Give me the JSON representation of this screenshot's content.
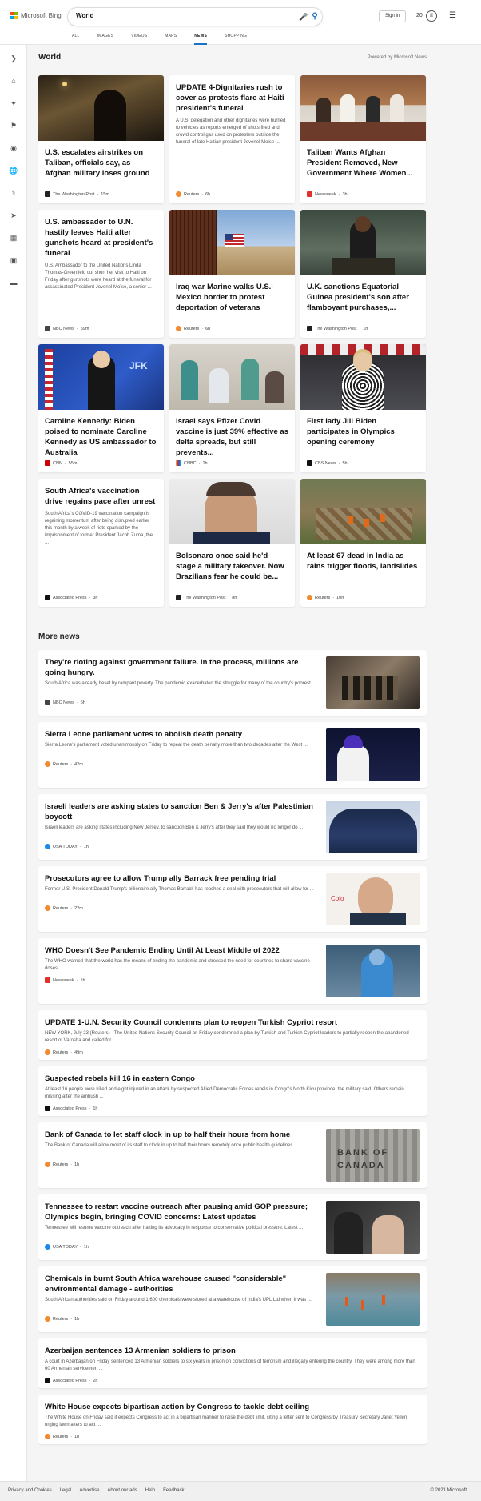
{
  "header": {
    "brand": "Microsoft Bing",
    "query": "World",
    "signin": "Sign in",
    "points": "20",
    "nav": [
      "ALL",
      "IMAGES",
      "VIDEOS",
      "MAPS",
      "NEWS",
      "SHOPPING"
    ],
    "active_nav": "NEWS"
  },
  "colors": {
    "accent": "#1a73c8",
    "ms_red": "#f25022",
    "ms_green": "#7fba00",
    "ms_blue": "#00a4ef",
    "ms_yellow": "#ffb900"
  },
  "sidebar": [
    "chevron-right-icon",
    "home-icon",
    "sparkle-icon",
    "flag-icon",
    "location-pin-icon",
    "globe-icon",
    "microscope-icon",
    "rocket-icon",
    "film-icon",
    "briefcase-icon",
    "card-icon"
  ],
  "section": {
    "title": "World",
    "powered": "Powered by Microsoft News"
  },
  "cards": [
    {
      "title": "U.S. escalates airstrikes on Taliban, officials say, as Afghan military loses ground",
      "source": "The Washington Post",
      "time": "15m"
    },
    {
      "title": "UPDATE 4-Dignitaries rush to cover as protests flare at Haiti president's funeral",
      "snippet": "A U.S. delegation and other dignitaries were hurried to vehicles as reports emerged of shots fired and crowd control gas used on protesters outside the funeral of late Haitian president Jovenel Moise ...",
      "source": "Reuters",
      "time": "6h"
    },
    {
      "title": "Taliban Wants Afghan President Removed, New Government Where Women...",
      "source": "Newsweek",
      "time": "3h"
    },
    {
      "title": "U.S. ambassador to U.N. hastily leaves Haiti after gunshots heard at president's funeral",
      "snippet": "U.S. Ambassador to the United Nations Linda Thomas-Greenfield cut short her visit to Haiti on Friday after gunshots were heard at the funeral for assassinated President Jovenel Moïse, a senior ...",
      "source": "NBC News",
      "time": "59m"
    },
    {
      "title": "Iraq war Marine walks U.S.-Mexico border to protest deportation of veterans",
      "source": "Reuters",
      "time": "6h"
    },
    {
      "title": "U.K. sanctions Equatorial Guinea president's son after flamboyant purchases,...",
      "source": "The Washington Post",
      "time": "1h"
    },
    {
      "title": "Caroline Kennedy: Biden poised to nominate Caroline Kennedy as US ambassador to Australia",
      "source": "CNN",
      "time": "55m"
    },
    {
      "title": "Israel says Pfizer Covid vaccine is just 39% effective as delta spreads, but still prevents...",
      "source": "CNBC",
      "time": "1h"
    },
    {
      "title": "First lady Jill Biden participates in Olympics opening ceremony",
      "source": "CBS News",
      "time": "5h"
    },
    {
      "title": "South Africa's vaccination drive regains pace after unrest",
      "snippet": "South Africa's COVID-19 vaccination campaign is regaining momentum after being disrupted earlier this month by a week of riots sparked by the imprisonment of former President Jacob Zuma, the ...",
      "source": "Associated Press",
      "time": "3h"
    },
    {
      "title": "Bolsonaro once said he'd stage a military takeover. Now Brazilians fear he could be...",
      "source": "The Washington Post",
      "time": "8h"
    },
    {
      "title": "At least 67 dead in India as rains trigger floods, landslides",
      "source": "Reuters",
      "time": "10h"
    }
  ],
  "more": {
    "title": "More news",
    "items": [
      {
        "title": "They're rioting against government failure. In the process, millions are going hungry.",
        "snippet": "South Africa was already beset by rampant poverty. The pandemic exacerbated the struggle for many of the country's poorest.",
        "source": "NBC News",
        "time": "6h"
      },
      {
        "title": "Sierra Leone parliament votes to abolish death penalty",
        "snippet": "Sierra Leone's parliament voted unanimously on Friday to repeal the death penalty more than two decades after the West ...",
        "source": "Reuters",
        "time": "42m"
      },
      {
        "title": "Israeli leaders are asking states to sanction Ben & Jerry's after Palestinian boycott",
        "snippet": "Israeli leaders are asking states including New Jersey, to sanction Ben & Jerry's after they said they would no longer do ...",
        "source": "USA TODAY",
        "time": "1h"
      },
      {
        "title": "Prosecutors agree to allow Trump ally Barrack free pending trial",
        "snippet": "Former U.S. President Donald Trump's billionaire ally Thomas Barrack has reached a deal with prosecutors that will allow for ...",
        "source": "Reuters",
        "time": "22m"
      },
      {
        "title": "WHO Doesn't See Pandemic Ending Until At Least Middle of 2022",
        "snippet": "The WHO warned that the world has the means of ending the pandemic and stressed the need for countries to share vaccine doses ...",
        "source": "Newsweek",
        "time": "1h"
      },
      {
        "title": "UPDATE 1-U.N. Security Council condemns plan to reopen Turkish Cypriot resort",
        "snippet": "NEW YORK, July 23 (Reuters) - The United Nations Security Council on Friday condemned a plan by Turkish and Turkish Cypriot leaders to partially reopen the abandoned resort of Varosha and called for ...",
        "source": "Reuters",
        "time": "49m"
      },
      {
        "title": "Suspected rebels kill 16 in eastern Congo",
        "snippet": "At least 16 people were killed and eight injured in an attack by suspected Allied Democratic Forces rebels in Congo's North Kivu province, the military said. Others remain missing after the ambush ...",
        "source": "Associated Press",
        "time": "1h"
      },
      {
        "title": "Bank of Canada to let staff clock in up to half their hours from home",
        "snippet": "The Bank of Canada will allow most of its staff to clock in up to half their hours remotely once public health guidelines ...",
        "source": "Reuters",
        "time": "1h"
      },
      {
        "title": "Tennessee to restart vaccine outreach after pausing amid GOP pressure; Olympics begin, bringing COVID concerns: Latest updates",
        "snippet": "Tennessee will resume vaccine outreach after halting its advocacy in response to conservative political pressure. Latest ...",
        "source": "USA TODAY",
        "time": "1h"
      },
      {
        "title": "Chemicals in burnt South Africa warehouse caused \"considerable\" environmental damage - authorities",
        "snippet": "South African authorities said on Friday around 1,600 chemicals were stored at a warehouse of India's UPL Ltd when it was ...",
        "source": "Reuters",
        "time": "1h"
      },
      {
        "title": "Azerbaijan sentences 13 Armenian soldiers to prison",
        "snippet": "A court in Azerbaijan on Friday sentenced 13 Armenian soldiers to six years in prison on convictions of terrorism and illegally entering the country. They were among more than 60 Armenian servicemen ...",
        "source": "Associated Press",
        "time": "2h"
      },
      {
        "title": "White House expects bipartisan action by Congress to tackle debt ceiling",
        "snippet": "The White House on Friday said it expects Congress to act in a bipartisan manner to raise the debt limit, citing a letter sent to Congress by Treasury Secretary Janet Yellen urging lawmakers to act ...",
        "source": "Reuters",
        "time": "1h"
      }
    ]
  },
  "footer": {
    "links": [
      "Privacy and Cookies",
      "Legal",
      "Advertise",
      "About our ads",
      "Help",
      "Feedback"
    ],
    "copyright": "© 2021 Microsoft"
  }
}
